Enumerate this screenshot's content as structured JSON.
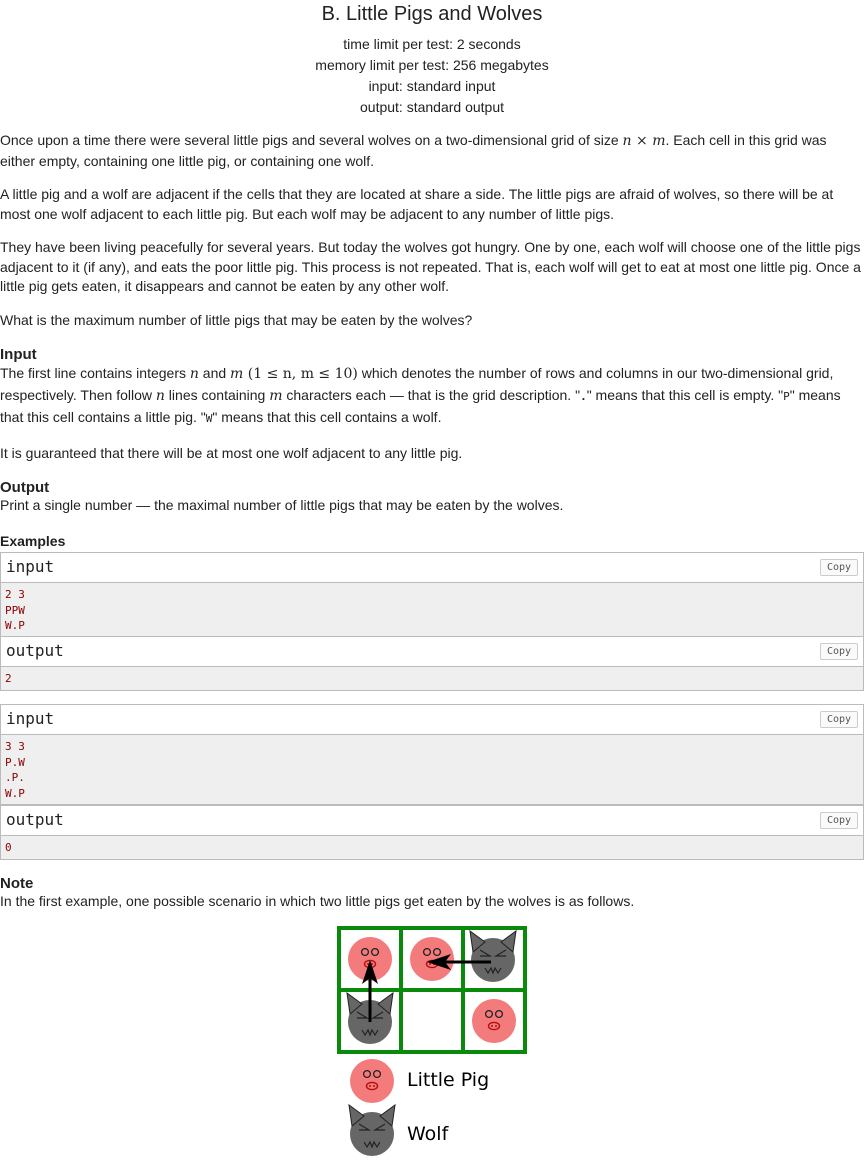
{
  "header": {
    "title": "B. Little Pigs and Wolves",
    "time_limit": "time limit per test: 2 seconds",
    "memory_limit": "memory limit per test: 256 megabytes",
    "input": "input: standard input",
    "output": "output: standard output"
  },
  "statement": {
    "p1_a": "Once upon a time there were several little pigs and several wolves on a two-dimensional grid of size ",
    "p1_math": "n × m",
    "p1_b": ". Each cell in this grid was either empty, containing one little pig, or containing one wolf.",
    "p2": "A little pig and a wolf are adjacent if the cells that they are located at share a side. The little pigs are afraid of wolves, so there will be at most one wolf adjacent to each little pig. But each wolf may be adjacent to any number of little pigs.",
    "p3": "They have been living peacefully for several years. But today the wolves got hungry. One by one, each wolf will choose one of the little pigs adjacent to it (if any), and eats the poor little pig. This process is not repeated. That is, each wolf will get to eat at most one little pig. Once a little pig gets eaten, it disappears and cannot be eaten by any other wolf.",
    "p4": "What is the maximum number of little pigs that may be eaten by the wolves?"
  },
  "input_section": {
    "title": "Input",
    "a": "The first line contains integers ",
    "n": "n",
    "and": " and ",
    "m": "m",
    "constraint": " (1 ≤ n, m ≤ 10)",
    "b": " which denotes the number of rows and columns in our two-dimensional grid, respectively. Then follow ",
    "c": " lines containing ",
    "d": " characters each — that is the grid description. \"",
    "dot": ".",
    "e": "\" means that this cell is empty. \"",
    "P": "P",
    "f": "\" means that this cell contains a little pig. \"",
    "W": "W",
    "g": "\" means that this cell contains a wolf.",
    "guarantee": "It is guaranteed that there will be at most one wolf adjacent to any little pig."
  },
  "output_section": {
    "title": "Output",
    "text": "Print a single number — the maximal number of little pigs that may be eaten by the wolves."
  },
  "examples": {
    "title": "Examples",
    "input_label": "input",
    "output_label": "output",
    "copy_label": "Copy",
    "ex1_input": "2 3\nPPW\nW.P",
    "ex1_output": "2",
    "ex2_input": "3 3\nP.W\n.P.\nW.P",
    "ex2_output": "0"
  },
  "note": {
    "title": "Note",
    "text": "In the first example, one possible scenario in which two little pigs get eaten by the wolves is as follows.",
    "legend_pig": "Little Pig",
    "legend_wolf": "Wolf"
  },
  "colors": {
    "grid": "#0a8a0a",
    "pig": "#f47b7b",
    "wolf": "#666666"
  }
}
